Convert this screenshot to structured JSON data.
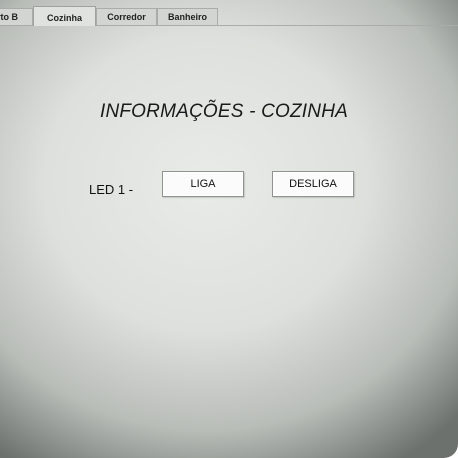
{
  "tabs": [
    {
      "label": "Quarto B",
      "active": false
    },
    {
      "label": "Cozinha",
      "active": true
    },
    {
      "label": "Corredor",
      "active": false
    },
    {
      "label": "Banheiro",
      "active": false
    }
  ],
  "main": {
    "title": "INFORMAÇÕES - COZINHA",
    "led": {
      "label": "LED 1 -",
      "on_label": "LIGA",
      "off_label": "DESLIGA"
    }
  }
}
